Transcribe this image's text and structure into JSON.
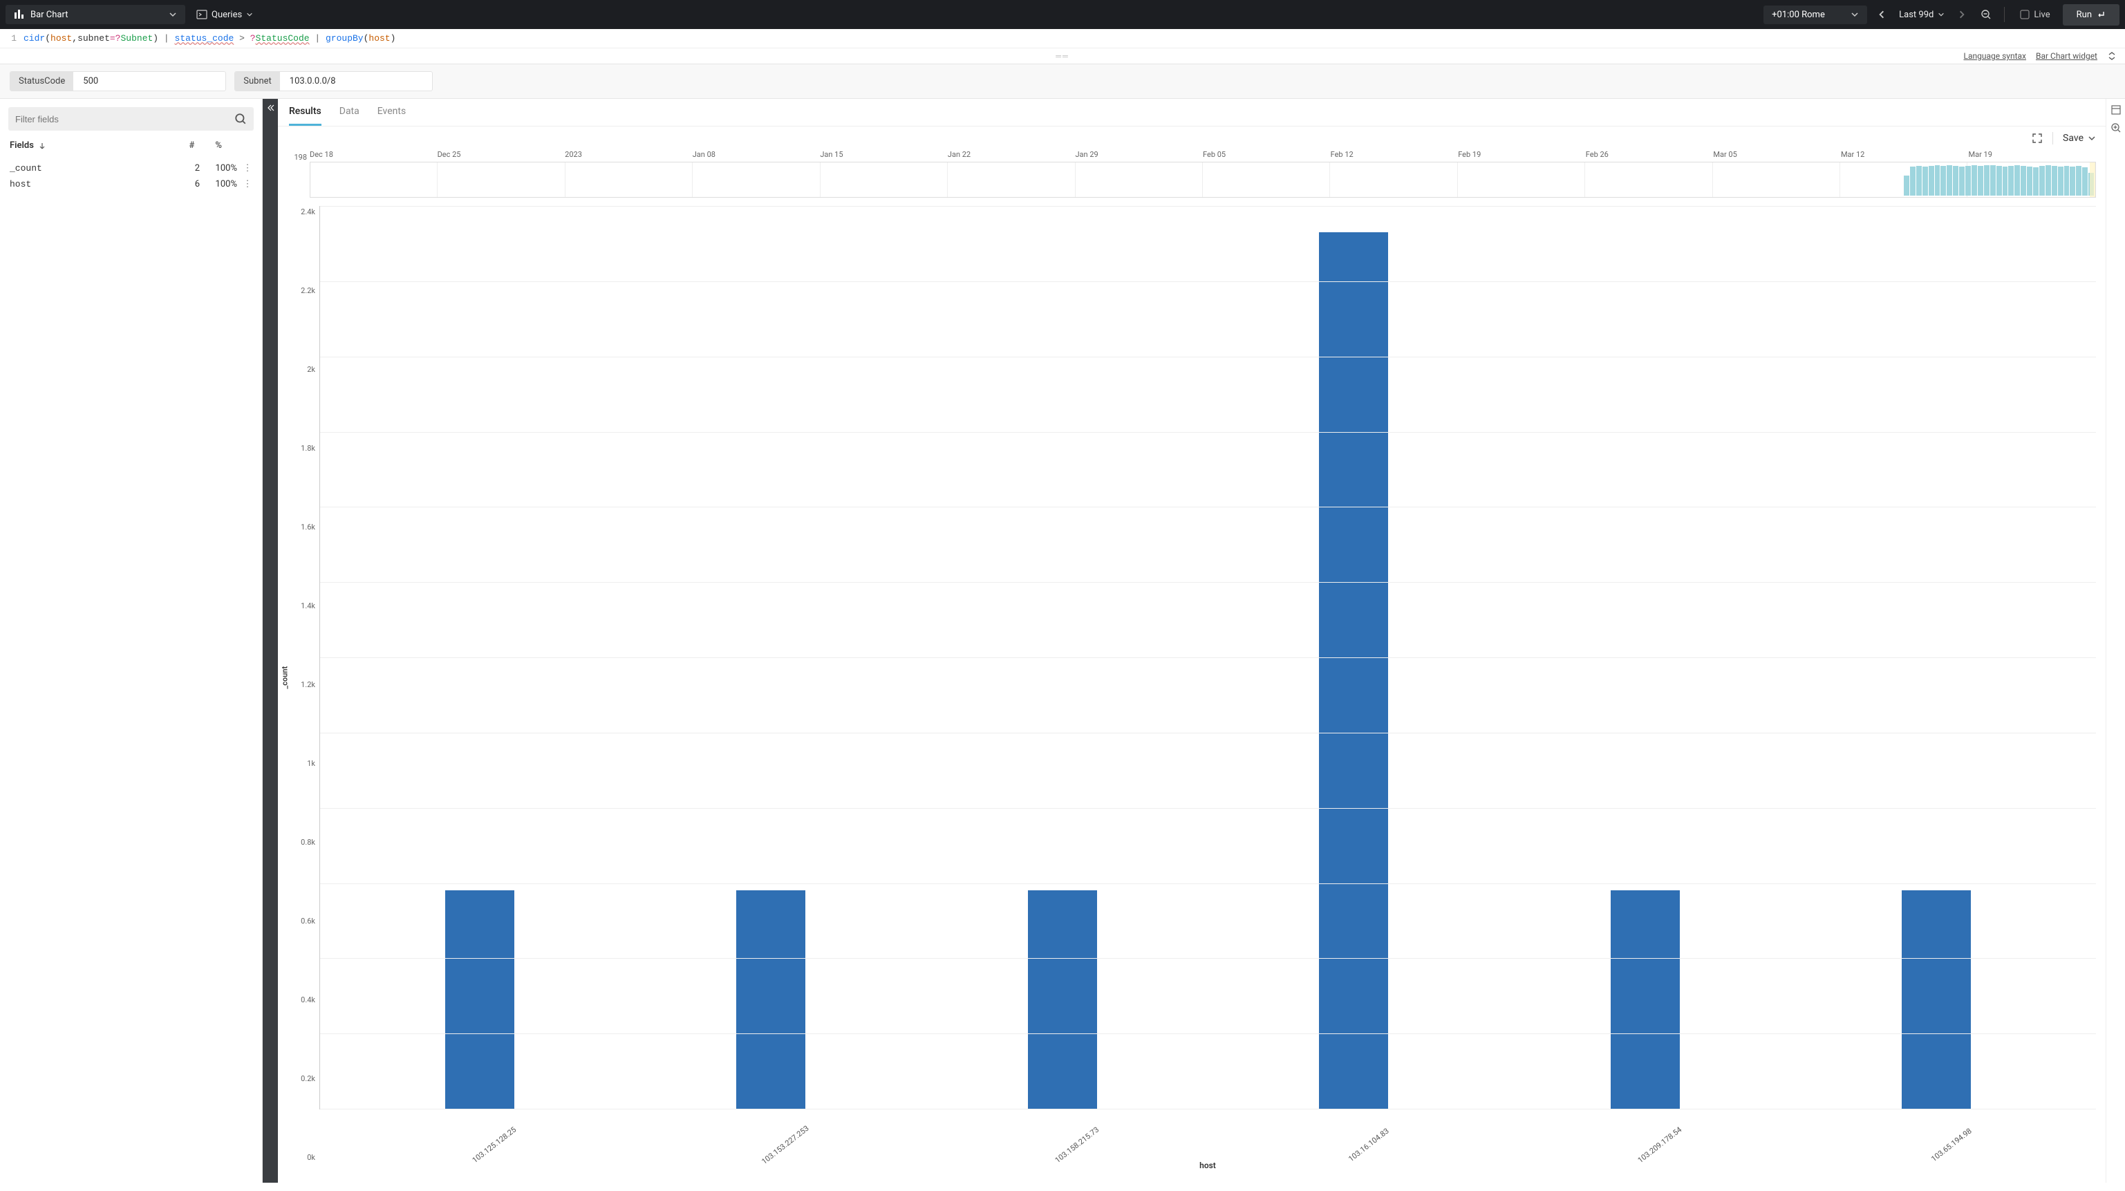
{
  "topbar": {
    "chart_type": "Bar Chart",
    "queries_label": "Queries",
    "timezone": "+01:00 Rome",
    "time_range": "Last 99d",
    "live_label": "Live",
    "run_label": "Run"
  },
  "query": {
    "line_no": "1",
    "tokens": {
      "cidr": "cidr",
      "host1": "host",
      "subnet_k": "subnet",
      "eq": "=?",
      "subnet_p": "Subnet",
      "close1": ")",
      "pipe1": " | ",
      "status_code": "status_code",
      "gt": " > ",
      "q": "?",
      "statuscode_p": "StatusCode",
      "pipe2": " | ",
      "groupby": "groupBy",
      "open2": "(",
      "host2": "host",
      "close2": ")"
    }
  },
  "links": {
    "lang": "Language syntax",
    "widget": "Bar Chart widget"
  },
  "params": {
    "status_code_k": "StatusCode",
    "status_code_v": "500",
    "subnet_k": "Subnet",
    "subnet_v": "103.0.0.0/8"
  },
  "sidebar": {
    "filter_placeholder": "Filter fields",
    "fields_header": "Fields",
    "col_hash": "#",
    "col_pct": "%",
    "rows": [
      {
        "name": "_count",
        "n": "2",
        "p": "100%"
      },
      {
        "name": "host",
        "n": "6",
        "p": "100%"
      }
    ]
  },
  "tabs": {
    "results": "Results",
    "data": "Data",
    "events": "Events"
  },
  "chart_toolbar": {
    "save": "Save"
  },
  "mini": {
    "y_value": "198",
    "dates": [
      "Dec 18",
      "Dec 25",
      "2023",
      "Jan 08",
      "Jan 15",
      "Jan 22",
      "Jan 29",
      "Feb 05",
      "Feb 12",
      "Feb 19",
      "Feb 26",
      "Mar 05",
      "Mar 12",
      "Mar 19"
    ]
  },
  "chart_data": {
    "type": "bar",
    "title": "",
    "xlabel": "host",
    "ylabel": "_count",
    "ylim": [
      0,
      2400
    ],
    "y_ticks": [
      "2.4k",
      "2.2k",
      "2k",
      "1.8k",
      "1.6k",
      "1.4k",
      "1.2k",
      "1k",
      "0.8k",
      "0.6k",
      "0.4k",
      "0.2k",
      "0k"
    ],
    "categories": [
      "103.125.128.25",
      "103.153.227.253",
      "103.158.215.73",
      "103.16.104.83",
      "103.209.178.54",
      "103.65.194.98"
    ],
    "values": [
      580,
      580,
      580,
      2330,
      580,
      580
    ]
  }
}
